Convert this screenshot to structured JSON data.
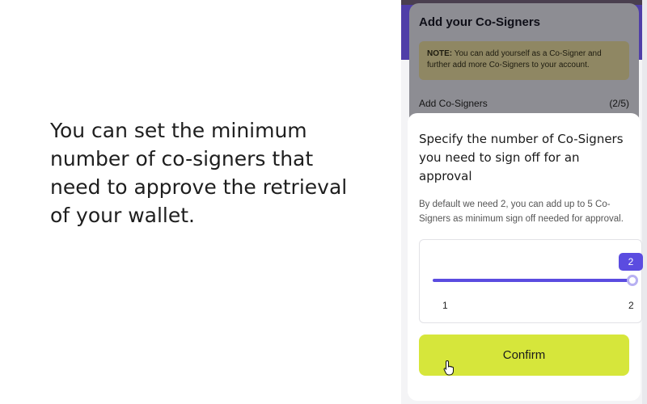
{
  "caption": {
    "lines": [
      "You can set the minimum",
      "number of co-signers that",
      "need to approve the retrieval",
      "of your wallet."
    ]
  },
  "background_screen": {
    "title": "Add your Co-Signers",
    "note_label": "NOTE:",
    "note_text": " You can add yourself as a Co-Signer and further add more Co-Signers to your account.",
    "add_label": "Add Co-Signers",
    "add_count": "(2/5)"
  },
  "modal": {
    "title": "Specify the number of Co-Signers you need to sign off for an approval",
    "description": "By default we need 2, you can add up to 5 Co-Signers as minimum sign off needed for approval.",
    "slider": {
      "min_label": "1",
      "max_label": "2",
      "value_label": "2",
      "value": 2,
      "min": 1,
      "max": 2
    },
    "confirm_label": "Confirm"
  },
  "colors": {
    "accent": "#5b4ce0",
    "confirm_button": "#d6e63b",
    "header": "#4f3ea8"
  },
  "icons": {
    "cursor": "hand-pointer-icon"
  }
}
